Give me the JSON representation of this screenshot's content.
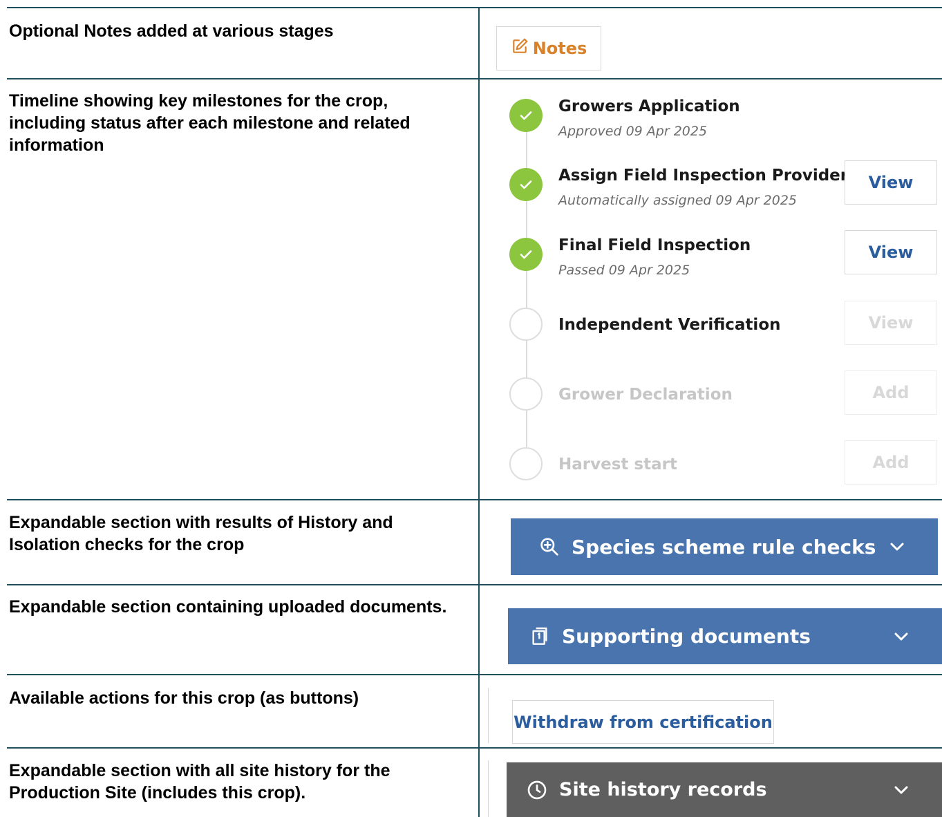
{
  "rows": [
    {
      "description": "Optional Notes added at various stages"
    },
    {
      "description": "Timeline showing key milestones for the crop, including status after each milestone and related information"
    },
    {
      "description": "Expandable section with results of History and Isolation checks for the crop"
    },
    {
      "description": "Expandable section containing uploaded documents."
    },
    {
      "description": "Available actions for this crop (as buttons)"
    },
    {
      "description": "Expandable section with all site history for the Production Site (includes this crop)."
    }
  ],
  "notes": {
    "label": "Notes",
    "color": "#d9822b",
    "icon": "edit-note-icon"
  },
  "timeline": {
    "steps": [
      {
        "title": "Growers Application",
        "status": "Approved 09 Apr 2025",
        "done": true
      },
      {
        "title": "Assign Field Inspection Provider",
        "status": "Automatically assigned 09 Apr 2025",
        "done": true,
        "action": "View"
      },
      {
        "title": "Final Field Inspection",
        "status": "Passed 09 Apr 2025",
        "done": true,
        "action": "View"
      },
      {
        "title": "Independent Verification",
        "done": false,
        "action": "View",
        "action_disabled": true
      },
      {
        "title": "Grower Declaration",
        "done": false,
        "muted": true,
        "action": "Add",
        "action_disabled": true
      },
      {
        "title": "Harvest start",
        "done": false,
        "muted": true,
        "action": "Add",
        "action_disabled": true
      }
    ],
    "done_color": "#8cc63f"
  },
  "sections": {
    "species": {
      "label": "Species scheme rule checks",
      "color": "#4a74ad",
      "icon": "zoom-in-icon"
    },
    "documents": {
      "label": "Supporting documents",
      "color": "#4a74ad",
      "icon": "documents-icon"
    },
    "site_history": {
      "label": "Site history records",
      "color": "#5f5f5f",
      "icon": "clock-icon"
    }
  },
  "actions": {
    "withdraw_label": "Withdraw from certification"
  }
}
